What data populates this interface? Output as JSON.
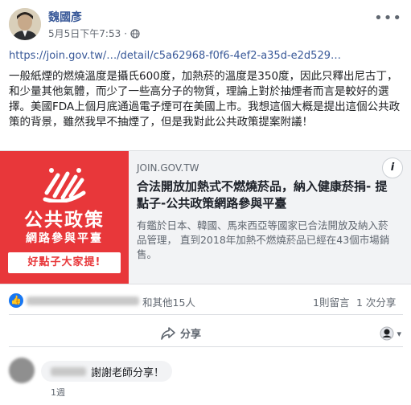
{
  "post": {
    "author": "魏國彥",
    "timestamp": "5月5日下午7:53",
    "privacy_icon": "globe-icon",
    "link_text": "https://join.gov.tw/…/detail/c5a62968-f0f6-4ef2-a35d-e2d529…",
    "body_text": "一般紙煙的燃燒溫度是攝氏600度，加熱菸的溫度是350度，因此只釋出尼古丁，和少量其他氣體，而少了一些高分子的物質，理論上對於抽煙者而言是較好的選擇。美國FDA上個月底通過電子煙可在美國上市。我想這個大概是提出這個公共政策的背景，雖然我早不抽煙了，但是我對此公共政策提案附議！"
  },
  "card": {
    "image_title": "公共政策",
    "image_subtitle": "網路參與平臺",
    "image_badge": "好點子大家提!",
    "domain": "JOIN.GOV.TW",
    "title": "合法開放加熱式不燃燒菸品，納入健康菸捐- 提點子-公共政策網路參與平臺",
    "description": "有鑑於日本、韓國、馬來西亞等國家已合法開放及納入菸品管理， 直到2018年加熱不燃燒菸品已經在43個市場銷售。",
    "info_label": "i"
  },
  "reactions": {
    "like_prefix": "E",
    "others_text": "和其他15人",
    "comments_text": "1則留言",
    "shares_text": "1 次分享"
  },
  "actions": {
    "share_label": "分享"
  },
  "comment": {
    "text": "謝謝老師分享！",
    "time": "1週"
  },
  "colors": {
    "link_blue": "#385898",
    "card_red": "#e8373a",
    "like_blue": "#1877f2"
  }
}
